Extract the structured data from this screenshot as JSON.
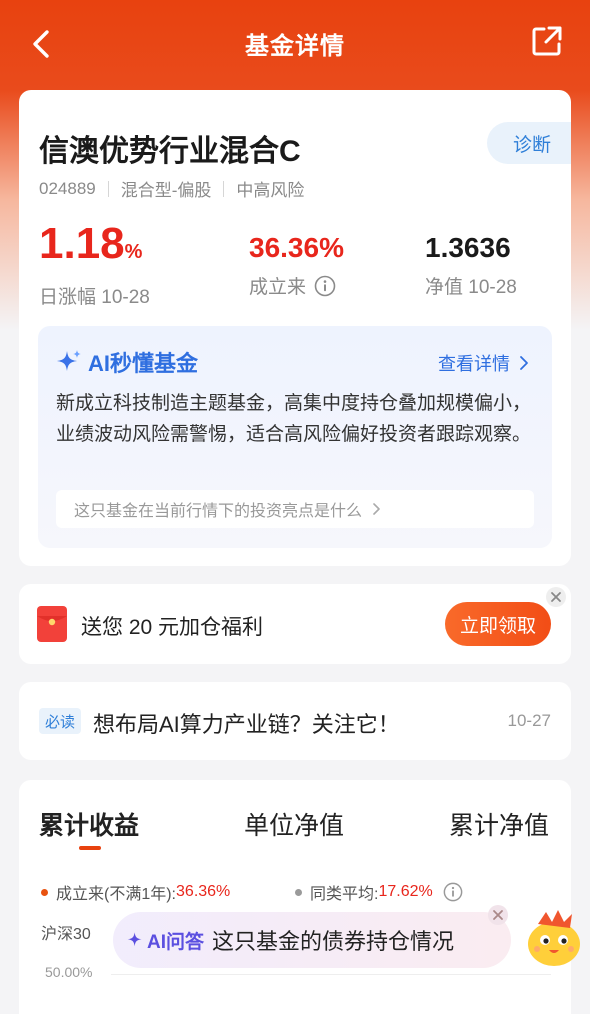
{
  "nav": {
    "title": "基金详情"
  },
  "fund": {
    "name": "信澳优势行业混合C",
    "diagnose_label": "诊断",
    "code": "024889",
    "type": "混合型-偏股",
    "risk": "中高风险",
    "day_change": "1.18",
    "day_change_unit": "%",
    "day_change_label": "日涨幅 10-28",
    "since_inception": "36.36%",
    "since_inception_label": "成立来",
    "nav_value": "1.3636",
    "nav_label": "净值 10-28"
  },
  "ai_summary": {
    "title": "AI秒懂基金",
    "more_label": "查看详情",
    "description": "新成立科技制造主题基金，高集中度持仓叠加规模偏小，业绩波动风险需警惕，适合高风险偏好投资者跟踪观察。",
    "question": "这只基金在当前行情下的投资亮点是什么"
  },
  "promo": {
    "text": "送您 20 元加仓福利",
    "button": "立即领取"
  },
  "news": {
    "tag": "必读",
    "headline": "想布局AI算力产业链？关注它！",
    "date": "10-27"
  },
  "chart": {
    "tabs": [
      "累计收益",
      "单位净值",
      "累计净值"
    ],
    "legend_fund_label": "成立来(不满1年): ",
    "legend_fund_value": "36.36%",
    "legend_peer_label": "同类平均: ",
    "legend_peer_value": "17.62%",
    "legend_index_label": "沪深30",
    "y_tick_top": "50.00%",
    "colors": {
      "fund": "#e8520f",
      "peer": "#9a9a9a",
      "index": "#2f7fd8"
    }
  },
  "ai_float": {
    "label": "AI问答",
    "question": "这只基金的债券持仓情况"
  },
  "colors": {
    "brand": "#e8420f",
    "up": "#e8261c",
    "link_blue": "#2f6fe0"
  }
}
